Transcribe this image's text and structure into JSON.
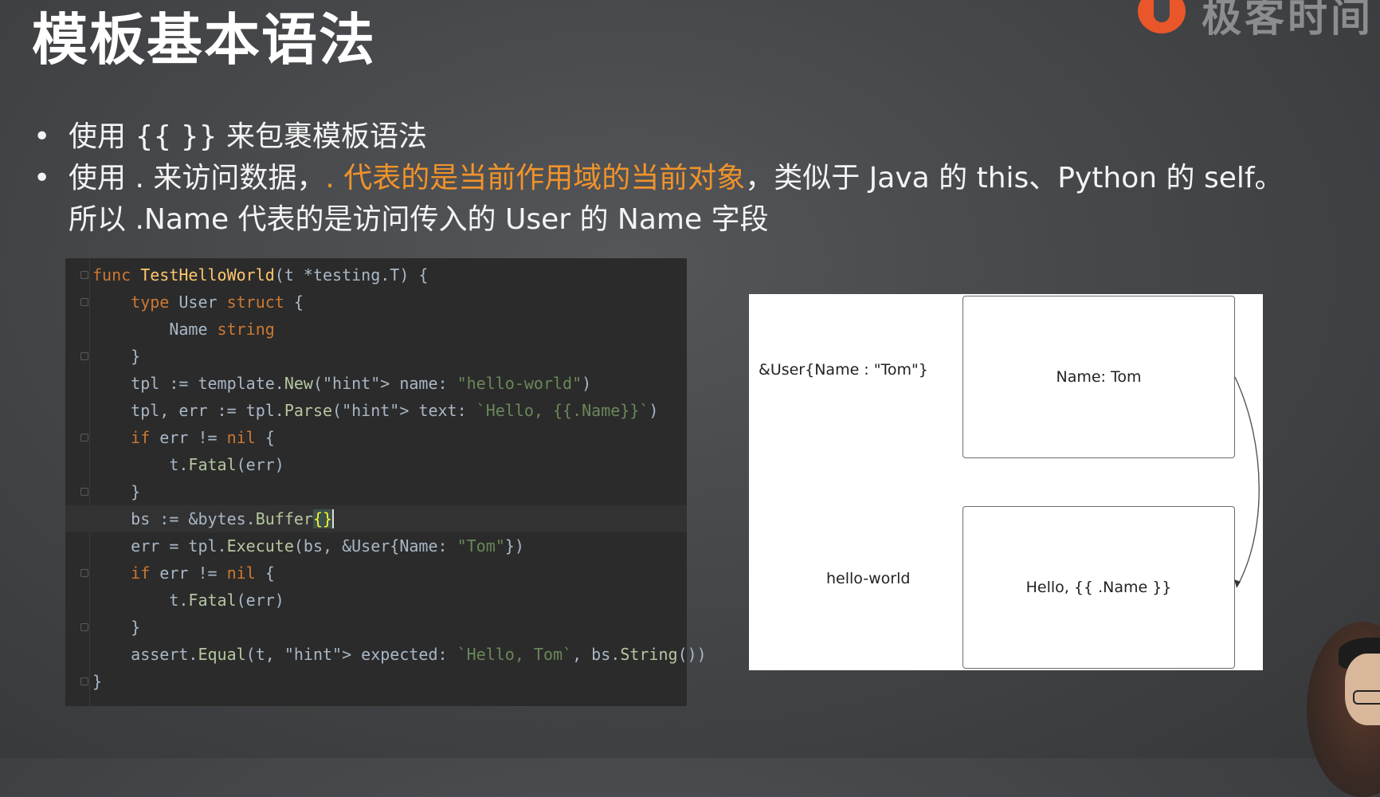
{
  "slide": {
    "title": "模板基本语法",
    "logo_text": "极客时间",
    "bullets": [
      {
        "marker": "•",
        "text": "使用 {{ }} 来包裹模板语法"
      },
      {
        "marker": "•",
        "text_before": "使用 . 来访问数据，",
        "highlight": ". 代表的是当前作用域的当前对象",
        "text_after": "，类似于 Java 的 this、Python 的 self。",
        "text_line2": "所以 .Name 代表的是访问传入的 User 的 Name 字段"
      }
    ]
  },
  "code": {
    "lines": [
      "func TestHelloWorld(t *testing.T) {",
      "    type User struct {",
      "        Name string",
      "    }",
      "    tpl := template.New( name: \"hello-world\")",
      "    tpl, err := tpl.Parse( text: `Hello, {{.Name}}`)",
      "    if err != nil {",
      "        t.Fatal(err)",
      "    }",
      "    bs := &bytes.Buffer{}",
      "    err = tpl.Execute(bs, &User{Name: \"Tom\"})",
      "    if err != nil {",
      "        t.Fatal(err)",
      "    }",
      "    assert.Equal(t,  expected: `Hello, Tom`, bs.String())",
      "}"
    ]
  },
  "diagram": {
    "left_top_label": "&User{Name : \"Tom\"}",
    "left_bottom_label": "hello-world",
    "top_box": "Name: Tom",
    "bottom_box": "Hello, {{ .Name }}"
  },
  "colors": {
    "highlight": "#f0932b",
    "keyword": "#cc7832",
    "function": "#ffc66d",
    "string": "#6a8759",
    "code_bg": "#2b2b2b"
  }
}
